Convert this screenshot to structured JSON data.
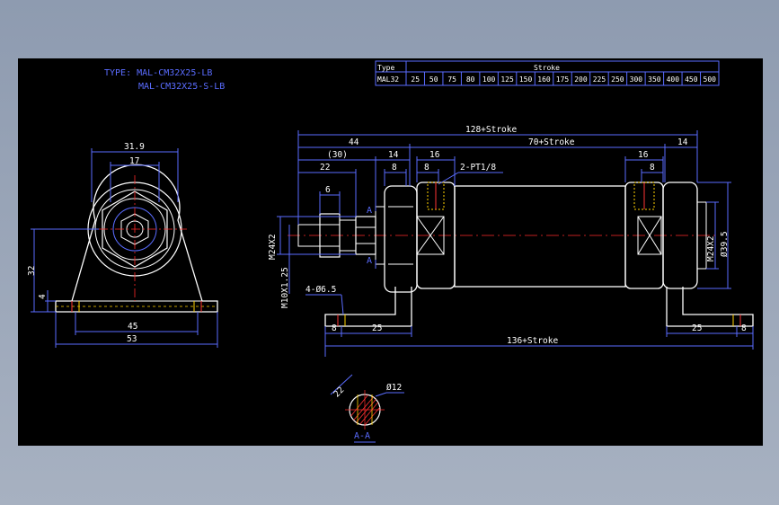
{
  "type_block": {
    "line1": "TYPE: MAL-CM32X25-LB",
    "line2": "MAL-CM32X25-S-LB"
  },
  "stroke_table": {
    "header_type": "Type",
    "header_stroke": "Stroke",
    "model": "MAL32",
    "strokes": [
      "25",
      "50",
      "75",
      "80",
      "100",
      "125",
      "150",
      "160",
      "175",
      "200",
      "225",
      "250",
      "300",
      "350",
      "400",
      "450",
      "500"
    ]
  },
  "front_view_dims": {
    "top": "31.9",
    "inner": "17",
    "height": "32",
    "base_t": "4",
    "hole_pitch": "45",
    "width": "53"
  },
  "side_view_dims": {
    "overall": "128+Stroke",
    "left_44": "44",
    "body": "70+Stroke",
    "right_14": "14",
    "d30": "(30)",
    "d14": "14",
    "d16a": "16",
    "d22": "22",
    "d8a": "8",
    "d8b": "8",
    "port": "2-PT1/8",
    "d16b": "16",
    "d8c": "8",
    "d6": "6",
    "thread_left": "M24X2",
    "thread_rod": "M10X1.25",
    "thread_right": "M24X2",
    "dia_right": "Ø39.5",
    "section_a_top": "A",
    "section_a_bottom": "A",
    "holes": "4-Ø6.5",
    "d8_bl": "8",
    "d25_bl": "25",
    "base_len": "136+Stroke",
    "d25_br": "25",
    "d8_br": "8"
  },
  "section_view": {
    "flat": "22",
    "dia": "Ø12",
    "label": "A-A"
  },
  "colors": {
    "background": "#000000",
    "outline": "#ffffff",
    "dimension": "#5a6cff",
    "centerline": "#ff2a2a",
    "hatch": "#ff3333",
    "highlight": "#ffd200"
  }
}
